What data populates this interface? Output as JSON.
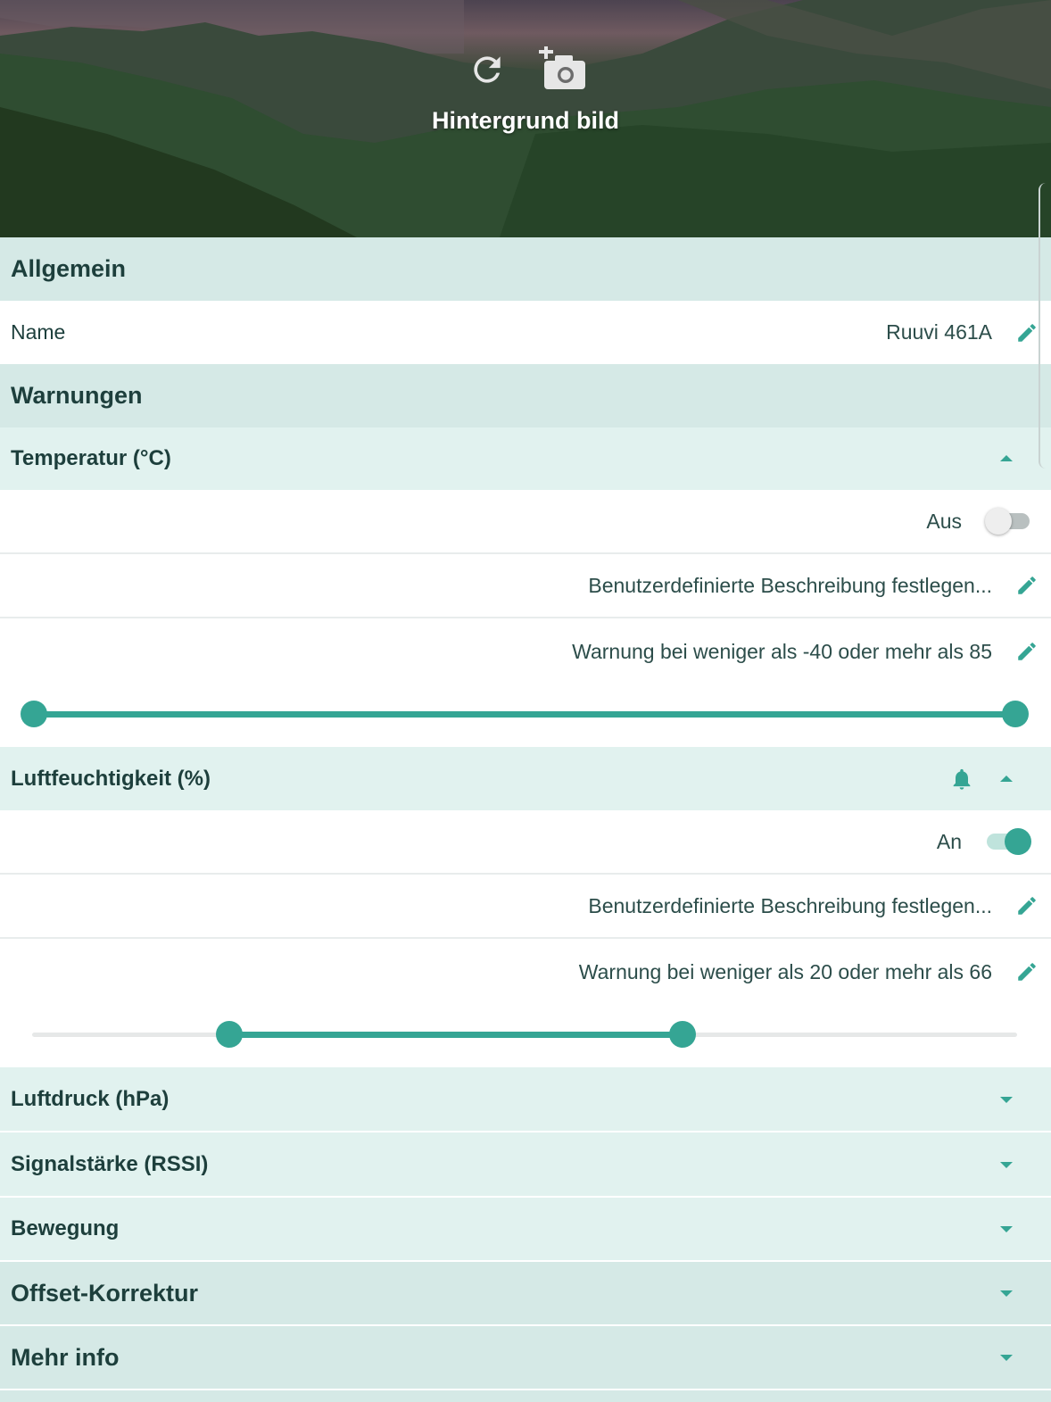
{
  "hero": {
    "title": "Hintergrund bild",
    "icons": [
      "refresh-icon",
      "add-photo-icon"
    ]
  },
  "general": {
    "header": "Allgemein",
    "name_label": "Name",
    "name_value": "Ruuvi 461A"
  },
  "alerts": {
    "header": "Warnungen",
    "temperature": {
      "label": "Temperatur (°C)",
      "toggle_label": "Aus",
      "enabled": false,
      "description": "Benutzerdefinierte Beschreibung festlegen...",
      "range_text": "Warnung bei weniger als -40 oder mehr als 85",
      "range_min": -40,
      "range_max": 85,
      "scale_min": -40,
      "scale_max": 85
    },
    "humidity": {
      "label": "Luftfeuchtigkeit (%)",
      "toggle_label": "An",
      "enabled": true,
      "description": "Benutzerdefinierte Beschreibung festlegen...",
      "range_text": "Warnung bei weniger als 20 oder mehr als 66",
      "range_min": 20,
      "range_max": 66,
      "scale_min": 0,
      "scale_max": 100
    },
    "pressure": {
      "label": "Luftdruck (hPa)"
    },
    "rssi": {
      "label": "Signalstärke (RSSI)"
    },
    "movement": {
      "label": "Bewegung"
    }
  },
  "offset": {
    "header": "Offset-Korrektur"
  },
  "more_info": {
    "header": "Mehr info"
  },
  "colors": {
    "accent": "#35a594",
    "section_bg": "#d5e9e6",
    "sub_bg": "#e1f2ef",
    "text": "#1d3f3c"
  }
}
